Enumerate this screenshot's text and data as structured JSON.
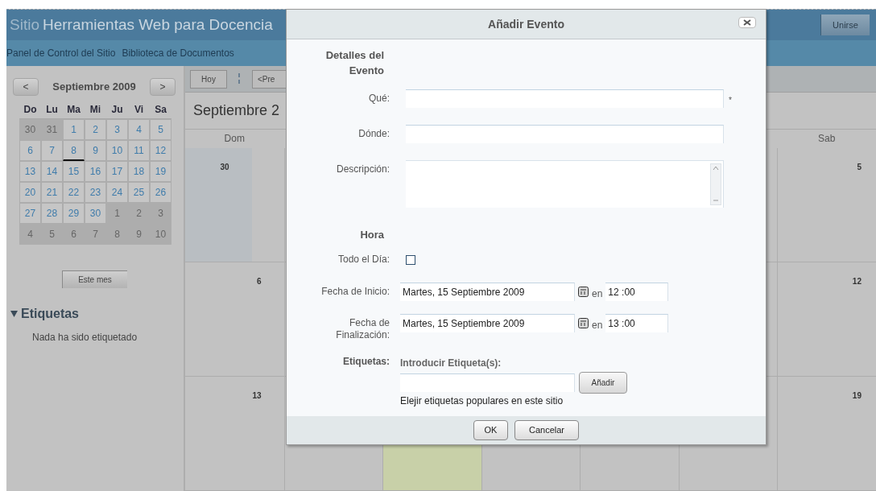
{
  "site": {
    "prefix": "Sitio",
    "title": "Herramientas Web para Docencia",
    "join_button": "Unirse"
  },
  "nav": [
    "Panel de Control del Sitio",
    "Biblioteca de Documentos"
  ],
  "mini_calendar": {
    "prev": "<",
    "month": "Septiembre 2009",
    "next": ">",
    "weekdays": [
      "Do",
      "Lu",
      "Ma",
      "Mi",
      "Ju",
      "Vi",
      "Sa"
    ],
    "weeks": [
      [
        {
          "day": "30",
          "other_month": true,
          "today": false
        },
        {
          "day": "31",
          "other_month": true,
          "today": false
        },
        {
          "day": "1",
          "other_month": false,
          "today": false
        },
        {
          "day": "2",
          "other_month": false,
          "today": false
        },
        {
          "day": "3",
          "other_month": false,
          "today": false
        },
        {
          "day": "4",
          "other_month": false,
          "today": false
        },
        {
          "day": "5",
          "other_month": false,
          "today": false
        }
      ],
      [
        {
          "day": "6",
          "other_month": false,
          "today": false
        },
        {
          "day": "7",
          "other_month": false,
          "today": false
        },
        {
          "day": "8",
          "other_month": false,
          "today": true
        },
        {
          "day": "9",
          "other_month": false,
          "today": false
        },
        {
          "day": "10",
          "other_month": false,
          "today": false
        },
        {
          "day": "11",
          "other_month": false,
          "today": false
        },
        {
          "day": "12",
          "other_month": false,
          "today": false
        }
      ],
      [
        {
          "day": "13",
          "other_month": false,
          "today": false
        },
        {
          "day": "14",
          "other_month": false,
          "today": false
        },
        {
          "day": "15",
          "other_month": false,
          "today": false
        },
        {
          "day": "16",
          "other_month": false,
          "today": false
        },
        {
          "day": "17",
          "other_month": false,
          "today": false
        },
        {
          "day": "18",
          "other_month": false,
          "today": false
        },
        {
          "day": "19",
          "other_month": false,
          "today": false
        }
      ],
      [
        {
          "day": "20",
          "other_month": false,
          "today": false
        },
        {
          "day": "21",
          "other_month": false,
          "today": false
        },
        {
          "day": "22",
          "other_month": false,
          "today": false
        },
        {
          "day": "23",
          "other_month": false,
          "today": false
        },
        {
          "day": "24",
          "other_month": false,
          "today": false
        },
        {
          "day": "25",
          "other_month": false,
          "today": false
        },
        {
          "day": "26",
          "other_month": false,
          "today": false
        }
      ],
      [
        {
          "day": "27",
          "other_month": false,
          "today": false
        },
        {
          "day": "28",
          "other_month": false,
          "today": false
        },
        {
          "day": "29",
          "other_month": false,
          "today": false
        },
        {
          "day": "30",
          "other_month": false,
          "today": false
        },
        {
          "day": "1",
          "other_month": true,
          "today": false
        },
        {
          "day": "2",
          "other_month": true,
          "today": false
        },
        {
          "day": "3",
          "other_month": true,
          "today": false
        }
      ],
      [
        {
          "day": "4",
          "other_month": true,
          "today": false
        },
        {
          "day": "5",
          "other_month": true,
          "today": false
        },
        {
          "day": "6",
          "other_month": true,
          "today": false
        },
        {
          "day": "7",
          "other_month": true,
          "today": false
        },
        {
          "day": "8",
          "other_month": true,
          "today": false
        },
        {
          "day": "9",
          "other_month": true,
          "today": false
        },
        {
          "day": "10",
          "other_month": true,
          "today": false
        }
      ]
    ],
    "this_month_button": "Este mes"
  },
  "tags_panel": {
    "title": "Etiquetas",
    "expanded": true,
    "empty_text": "Nada ha sido etiquetado"
  },
  "month_view": {
    "today_button": "Hoy",
    "prev_button": "<Pre",
    "title": "Septiembre 2",
    "first_weekday": "Dom",
    "last_weekday": "Sab",
    "weeks": [
      {
        "first_day": "30",
        "first_other_month": true,
        "last_day": "5",
        "today_in_week": false
      },
      {
        "first_day": "6",
        "first_other_month": false,
        "last_day": "12",
        "today_in_week": false
      },
      {
        "first_day": "13",
        "first_other_month": false,
        "last_day": "19",
        "today_in_week": true
      }
    ]
  },
  "dialog": {
    "title": "Añadir Evento",
    "rows": [
      {
        "kind": "heading",
        "label": "Detalles del Evento"
      },
      {
        "kind": "text",
        "label": "Qué:",
        "required_mark": "*"
      },
      {
        "kind": "text",
        "label": "Dónde:"
      },
      {
        "kind": "textarea",
        "label": "Descripción:"
      },
      {
        "kind": "heading",
        "label": "Hora"
      },
      {
        "kind": "checkbox",
        "label": "Todo el Día:",
        "checked": false
      },
      {
        "kind": "datetime",
        "label": "Fecha de Inicio:",
        "date": "Martes, 15 Septiembre 2009",
        "at": "en",
        "time": "12 :00"
      },
      {
        "kind": "datetime",
        "label": "Fecha de Finalización:",
        "date": "Martes, 15 Septiembre 2009",
        "at": "en",
        "time": "13 :00"
      },
      {
        "kind": "tags",
        "label": "Etiquetas:",
        "prompt": "Introducir Etiqueta(s):",
        "button": "Añadir",
        "hint": "Elejir etiquetas populares en este sitio"
      }
    ],
    "buttons": [
      "OK",
      "Cancelar"
    ]
  }
}
